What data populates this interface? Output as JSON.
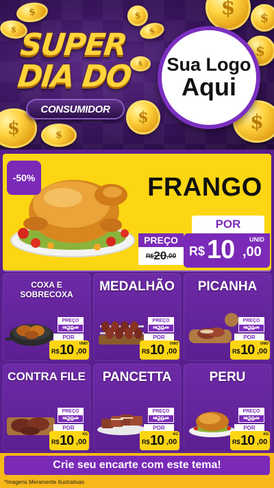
{
  "header": {
    "title_line1": "SUPER",
    "title_line2": "DIA DO",
    "title_line3": "CONSUMIDOR",
    "logo_line1": "Sua Logo",
    "logo_line2": "Aqui"
  },
  "featured": {
    "discount": "-50%",
    "name": "FRANGO",
    "por_label": "POR",
    "preco_label": "PREÇO",
    "old_currency": "R$",
    "old_value": "20",
    "old_cents": ",00",
    "new_currency": "R$",
    "new_value": "10",
    "new_cents": ",00",
    "unit": "UNID"
  },
  "products": [
    {
      "name": "COXA E SOBRECOXA",
      "preco_label": "PREÇO",
      "old_value": "20",
      "old_cents": ",00",
      "por_label": "POR",
      "currency": "R$",
      "value": "10",
      "cents": ",00",
      "unit": "UNID"
    },
    {
      "name": "MEDALHÃO",
      "preco_label": "PREÇO",
      "old_value": "20",
      "old_cents": ",00",
      "por_label": "POR",
      "currency": "R$",
      "value": "10",
      "cents": ",00",
      "unit": "UNID"
    },
    {
      "name": "PICANHA",
      "preco_label": "PREÇO",
      "old_value": "20",
      "old_cents": ",00",
      "por_label": "POR",
      "currency": "R$",
      "value": "10",
      "cents": ",00",
      "unit": "UNID"
    },
    {
      "name": "CONTRA FILE",
      "preco_label": "PREÇO",
      "old_value": "20",
      "old_cents": ",00",
      "por_label": "POR",
      "currency": "R$",
      "value": "10",
      "cents": ",00",
      "unit": "KG"
    },
    {
      "name": "PANCETTA",
      "preco_label": "PREÇO",
      "old_value": "20",
      "old_cents": ",00",
      "por_label": "POR",
      "currency": "R$",
      "value": "10",
      "cents": ",00",
      "unit": "KG"
    },
    {
      "name": "PERU",
      "preco_label": "PREÇO",
      "old_value": "20",
      "old_cents": ",00",
      "por_label": "POR",
      "currency": "R$",
      "value": "10",
      "cents": ",00",
      "unit": "KG"
    }
  ],
  "footer": {
    "cta": "Crie seu encarte com este tema!",
    "disclaimer": "*Imagens Meramente Ilustrativas"
  },
  "colors": {
    "purple": "#7b2ab8",
    "yellow": "#fcd612",
    "gold": "#f7b81a"
  }
}
